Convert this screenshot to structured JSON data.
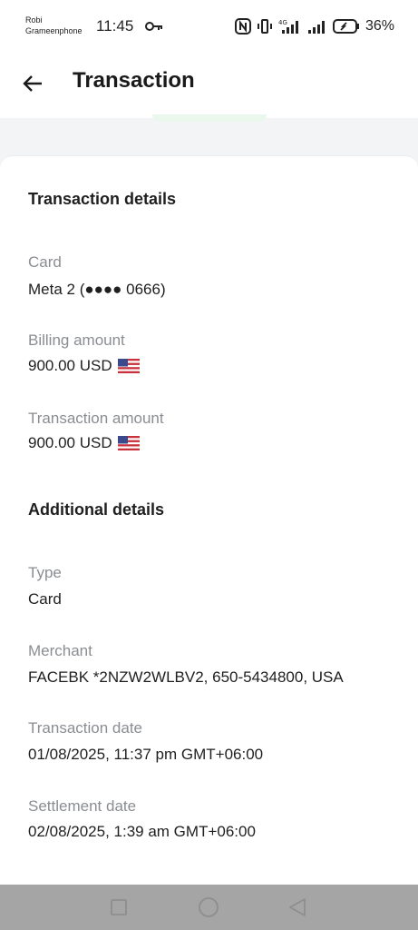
{
  "status_bar": {
    "carrier_line1": "Robi",
    "carrier_line2": "Grameenphone",
    "time": "11:45",
    "battery": "36%"
  },
  "app_bar": {
    "title": "Transaction"
  },
  "transaction_details": {
    "heading": "Transaction details",
    "card_label": "Card",
    "card_value": "Meta 2 (●●●● 0666)",
    "billing_label": "Billing amount",
    "billing_value": "900.00 USD",
    "transaction_amount_label": "Transaction amount",
    "transaction_amount_value": "900.00 USD",
    "currency_flag_icon": "us-flag-icon"
  },
  "additional_details": {
    "heading": "Additional details",
    "type_label": "Type",
    "type_value": "Card",
    "merchant_label": "Merchant",
    "merchant_value": "FACEBK *2NZW2WLBV2, 650-5434800, USA",
    "transaction_date_label": "Transaction date",
    "transaction_date_value": "01/08/2025, 11:37 pm GMT+06:00",
    "settlement_date_label": "Settlement date",
    "settlement_date_value": "02/08/2025, 1:39 am GMT+06:00"
  },
  "nav_bar": {
    "buttons": [
      "recent-apps-icon",
      "home-icon",
      "back-triangle-icon"
    ]
  },
  "colors": {
    "accent_peek": "#e9f7ec",
    "label_grey": "#8a8d91",
    "nav_bar": "#a5a5a5"
  }
}
